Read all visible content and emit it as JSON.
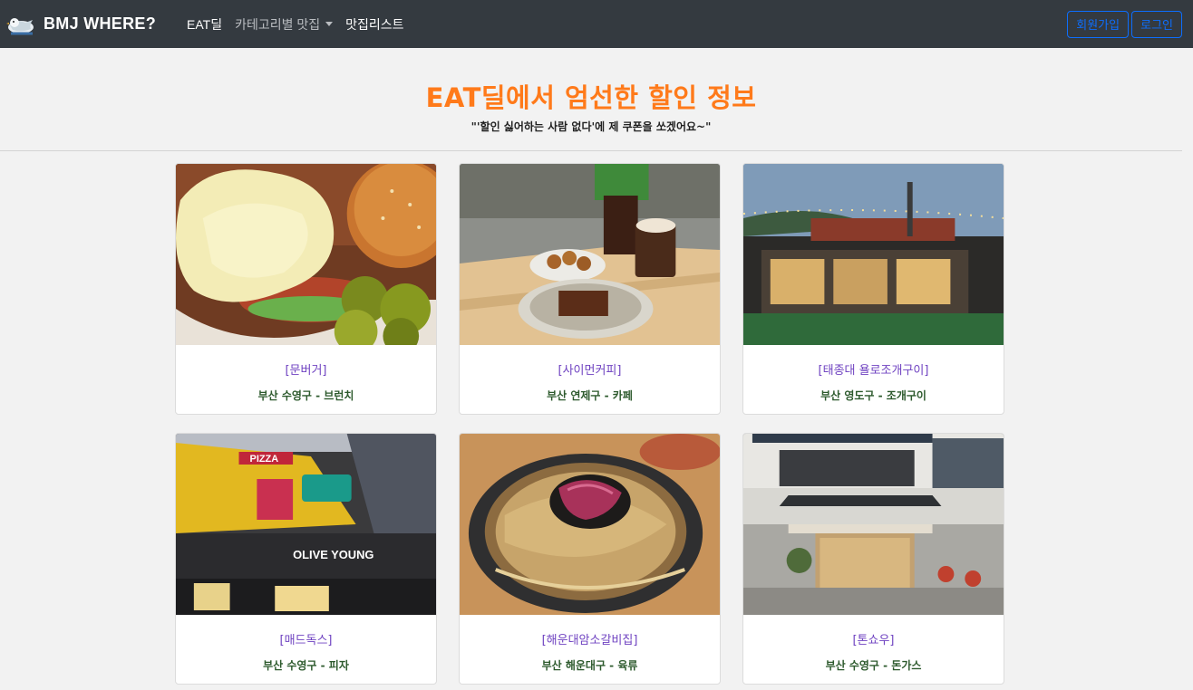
{
  "navbar": {
    "brand": "BMJ WHERE?",
    "links": [
      {
        "label": "EAT딜"
      },
      {
        "label": "카테고리별 맛집"
      },
      {
        "label": "맛집리스트"
      }
    ],
    "signup": "회원가입",
    "login": "로그인"
  },
  "hero": {
    "title": "EAT딜에서 엄선한 할인 정보",
    "subtitle": "\"'할인 싫어하는 사람 없다'에 제 쿠폰을 쏘겠어요~\""
  },
  "restaurants": [
    {
      "name": "[문버거]",
      "info": "부산 수영구 - 브런치"
    },
    {
      "name": "[사이먼커피]",
      "info": "부산 연제구 - 카페"
    },
    {
      "name": "[태종대 욜로조개구이]",
      "info": "부산 영도구 - 조개구이"
    },
    {
      "name": "[매드독스]",
      "info": "부산 수영구 - 피자"
    },
    {
      "name": "[해운대암소갈비집]",
      "info": "부산 해운대구 - 육류"
    },
    {
      "name": "[톤쇼우]",
      "info": "부산 수영구 - 돈가스"
    }
  ],
  "photo_labels": {
    "pizza_sign": "PIZZA",
    "olive_sign": "OLIVE YOUNG"
  }
}
